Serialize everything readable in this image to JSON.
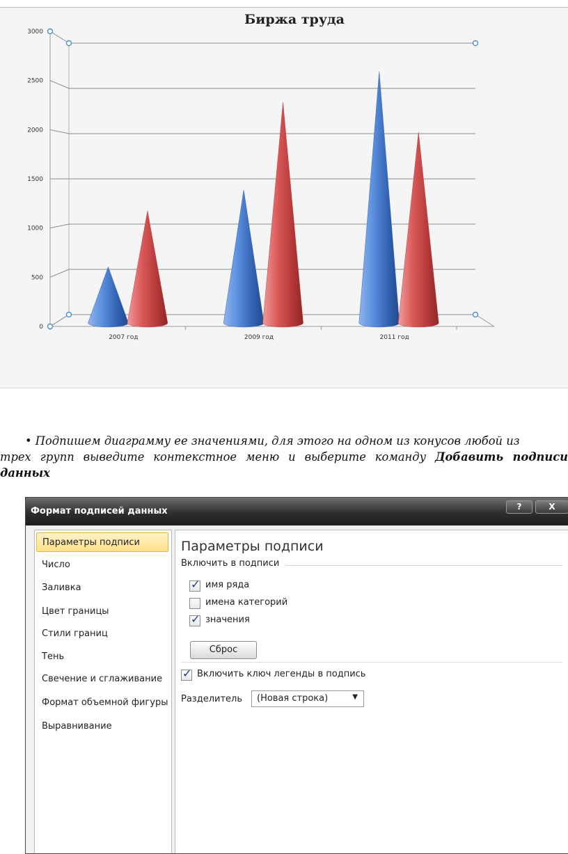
{
  "chart_data": {
    "type": "bar",
    "title": "Биржа труда",
    "categories": [
      "2007 год",
      "2009 год",
      "2011 год"
    ],
    "series": [
      {
        "values": [
          620,
          1470,
          2780
        ],
        "color": "#4a7fcf"
      },
      {
        "values": [
          1240,
          2440,
          2110
        ],
        "color": "#d65a5a"
      }
    ],
    "ylim": [
      0,
      3000
    ],
    "yticks": [
      "0",
      "500",
      "1000",
      "1500",
      "2000",
      "2500",
      "3000"
    ],
    "grid": true,
    "bar_shape": "cone"
  },
  "instruction": {
    "bullet": "•",
    "text_part1": "Подпишем диаграмму ее значениями, для этого на одном из конусов любой из",
    "text_part2": "трех групп выведите контекстное меню и выберите команду ",
    "command": "Добавить подписи",
    "command_tail": "данных"
  },
  "dialog": {
    "title": "Формат подписей данных",
    "help_label": "?",
    "close_label": "X",
    "nav_items": [
      "Параметры подписи",
      "Число",
      "Заливка",
      "Цвет границы",
      "Стили границ",
      "Тень",
      "Свечение и сглаживание",
      "Формат объемной фигуры",
      "Выравнивание"
    ],
    "active_nav": 0,
    "section_title": "Параметры подписи",
    "group_label": "Включить в подписи",
    "checkboxes": [
      {
        "label": "имя ряда",
        "checked": true
      },
      {
        "label": "имена категорий",
        "checked": false
      },
      {
        "label": "значения",
        "checked": true
      }
    ],
    "reset_label": "Сброс",
    "legend_key": {
      "label": "Включить ключ легенды в подпись",
      "checked": true
    },
    "separator_label": "Разделитель",
    "separator_value": "(Новая строка)"
  }
}
